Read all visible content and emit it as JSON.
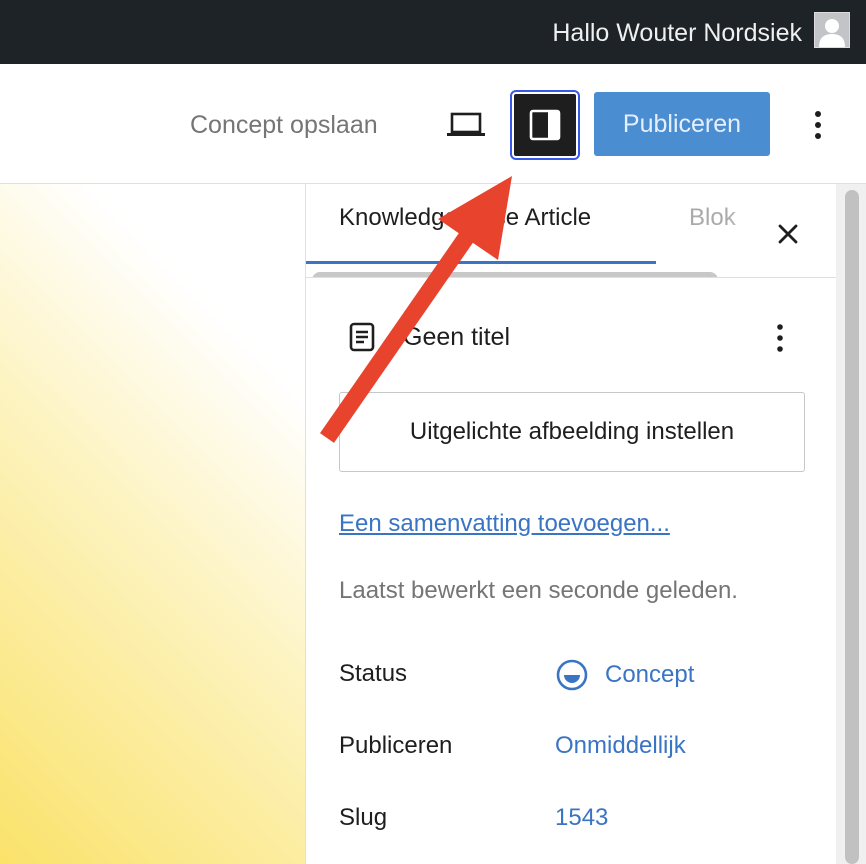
{
  "admin_bar": {
    "greeting": "Hallo Wouter Nordsiek"
  },
  "header": {
    "save_draft_label": "Concept opslaan",
    "publish_label": "Publiceren"
  },
  "sidebar": {
    "tabs": [
      {
        "label": "Knowledge Base Article",
        "active": true
      },
      {
        "label": "Blok",
        "active": false
      }
    ],
    "post_title": "Geen titel",
    "featured_image_label": "Uitgelichte afbeelding instellen",
    "excerpt_link": "Een samenvatting toevoegen...",
    "last_edited": "Laatst bewerkt een seconde geleden.",
    "rows": [
      {
        "label": "Status",
        "value": "Concept",
        "icon": "half-circle-status-icon"
      },
      {
        "label": "Publiceren",
        "value": "Onmiddellijk"
      },
      {
        "label": "Slug",
        "value": "1543"
      }
    ]
  },
  "colors": {
    "admin_bar": "#1d2327",
    "accent": "#3a74c4",
    "publish_button": "#4a8dd0",
    "annotation_arrow": "#e8432d"
  }
}
